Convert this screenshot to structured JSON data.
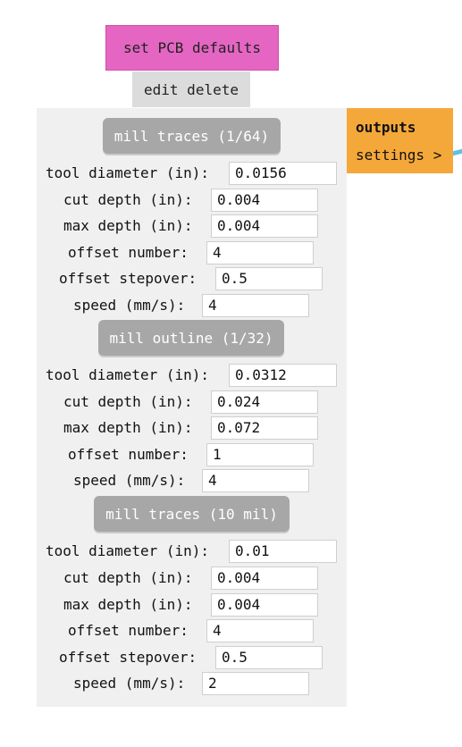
{
  "header": {
    "title_button": "set PCB defaults",
    "edit_delete": "edit delete"
  },
  "outputs": {
    "title": "outputs",
    "settings": "settings >"
  },
  "sections": [
    {
      "title": "mill traces (1/64)",
      "fields": [
        {
          "label": "tool diameter (in):",
          "value": "0.0156"
        },
        {
          "label": "cut depth (in):",
          "value": "0.004"
        },
        {
          "label": "max depth (in):",
          "value": "0.004"
        },
        {
          "label": "offset number:",
          "value": "4"
        },
        {
          "label": "offset stepover:",
          "value": "0.5"
        },
        {
          "label": "speed (mm/s):",
          "value": "4"
        }
      ]
    },
    {
      "title": "mill outline (1/32)",
      "fields": [
        {
          "label": "tool diameter (in):",
          "value": "0.0312"
        },
        {
          "label": "cut depth (in):",
          "value": "0.024"
        },
        {
          "label": "max depth (in):",
          "value": "0.072"
        },
        {
          "label": "offset number:",
          "value": "1"
        },
        {
          "label": "speed (mm/s):",
          "value": "4"
        }
      ]
    },
    {
      "title": "mill traces (10 mil)",
      "fields": [
        {
          "label": "tool diameter (in):",
          "value": "0.01"
        },
        {
          "label": "cut depth (in):",
          "value": "0.004"
        },
        {
          "label": "max depth (in):",
          "value": "0.004"
        },
        {
          "label": "offset number:",
          "value": "4"
        },
        {
          "label": "offset stepover:",
          "value": "0.5"
        },
        {
          "label": "speed (mm/s):",
          "value": "2"
        }
      ]
    }
  ]
}
